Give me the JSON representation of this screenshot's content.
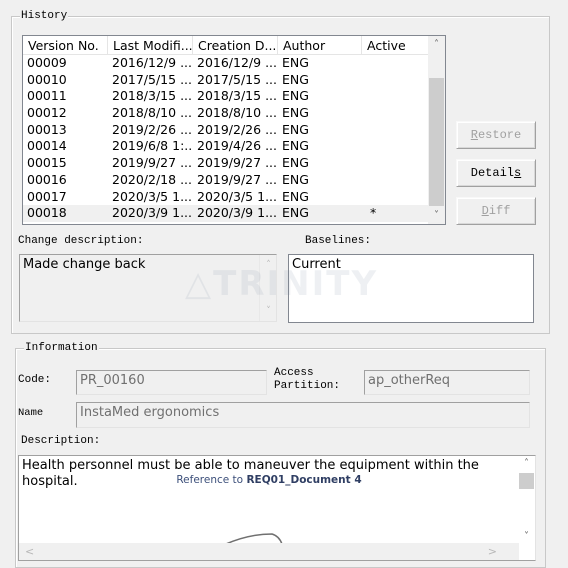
{
  "history": {
    "title": "History",
    "columns": [
      "Version No.",
      "Last Modifi...",
      "Creation D...",
      "Author",
      "Active"
    ],
    "rows": [
      {
        "version": "00009",
        "last_modified": "2016/12/9 ...",
        "created": "2016/12/9 ...",
        "author": "ENG",
        "active": ""
      },
      {
        "version": "00010",
        "last_modified": "2017/5/15 ...",
        "created": "2017/5/15 ...",
        "author": "ENG",
        "active": ""
      },
      {
        "version": "00011",
        "last_modified": "2018/3/15 ...",
        "created": "2018/3/15 ...",
        "author": "ENG",
        "active": ""
      },
      {
        "version": "00012",
        "last_modified": "2018/8/10 ...",
        "created": "2018/8/10 ...",
        "author": "ENG",
        "active": ""
      },
      {
        "version": "00013",
        "last_modified": "2019/2/26 ...",
        "created": "2019/2/26 ...",
        "author": "ENG",
        "active": ""
      },
      {
        "version": "00014",
        "last_modified": "2019/6/8 1:...",
        "created": "2019/4/26 ...",
        "author": "ENG",
        "active": ""
      },
      {
        "version": "00015",
        "last_modified": "2019/9/27 ...",
        "created": "2019/9/27 ...",
        "author": "ENG",
        "active": ""
      },
      {
        "version": "00016",
        "last_modified": "2020/2/18 ...",
        "created": "2019/9/27 ...",
        "author": "ENG",
        "active": ""
      },
      {
        "version": "00017",
        "last_modified": "2020/3/5 1...",
        "created": "2020/3/5 1...",
        "author": "ENG",
        "active": ""
      },
      {
        "version": "00018",
        "last_modified": "2020/3/9 1...",
        "created": "2020/3/9 1...",
        "author": "ENG",
        "active": "*"
      }
    ],
    "selected_row": 9,
    "buttons": {
      "restore": {
        "mnemonic": "R",
        "rest": "estore",
        "enabled": false
      },
      "details": {
        "pre": "Detail",
        "mnemonic": "s",
        "enabled": true
      },
      "diff": {
        "mnemonic": "D",
        "rest": "iff",
        "enabled": false
      }
    },
    "change_description_label": "Change description:",
    "change_description": "Made change back",
    "baselines_label": "Baselines:",
    "baselines": [
      "Current"
    ]
  },
  "watermark": "TRINITY",
  "information": {
    "title": "Information",
    "code_label": "Code:",
    "code_value": "PR_00160",
    "access_partition_label_1": "Access",
    "access_partition_label_2": "Partition:",
    "access_partition_value": "ap_otherReq",
    "name_label": "Name",
    "name_value": "InstaMed ergonomics",
    "description_label": "Description:",
    "description_text": "Health personnel must be able to maneuver the equipment within the hospital.",
    "reference_prefix": "Reference to ",
    "reference_target": "REQ01_Document 4"
  }
}
